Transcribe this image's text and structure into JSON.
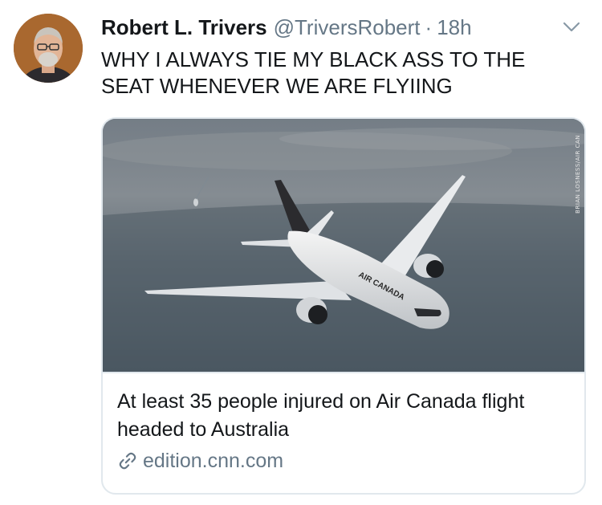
{
  "tweet": {
    "author_name": "Robert L. Trivers",
    "author_handle": "@TriversRobert",
    "separator": "·",
    "time_ago": "18h",
    "text": "WHY I ALWAYS TIE MY BLACK ASS TO THE SEAT WHENEVER WE ARE FLYIING",
    "avatar_icon": "avatar-photo",
    "menu_icon": "chevron-down-icon"
  },
  "card": {
    "image_subject": "airplane-photo",
    "airline_livery": "AIR CANADA",
    "watermark": "BRIAN LOSNESS/AIR CAN",
    "title": "At least 35 people injured on Air Canada flight headed to Australia",
    "domain": "edition.cnn.com",
    "link_icon": "link-icon"
  },
  "colors": {
    "text": "#14171a",
    "secondary": "#657786",
    "border": "#e1e8ed"
  }
}
